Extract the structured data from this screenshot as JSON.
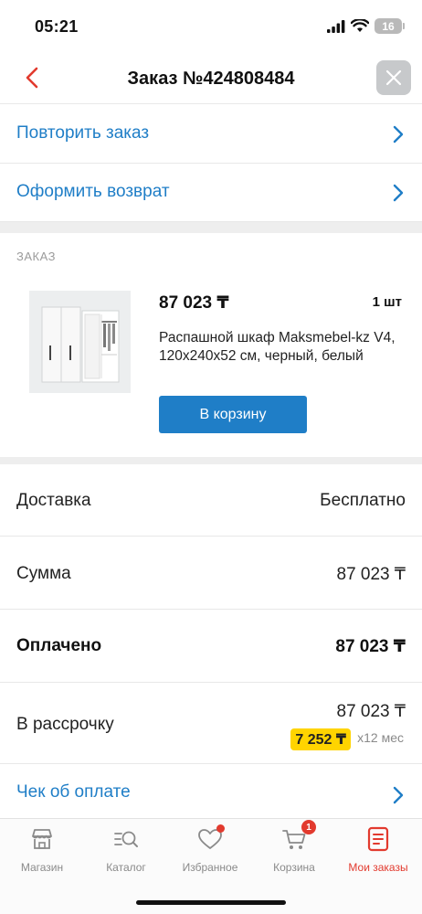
{
  "status_bar": {
    "time": "05:21",
    "battery": "16"
  },
  "header": {
    "title": "Заказ №424808484"
  },
  "actions": [
    {
      "label": "Повторить заказ"
    },
    {
      "label": "Оформить возврат"
    }
  ],
  "order_section": {
    "label": "ЗАКАЗ",
    "item": {
      "price": "87 023 ₸",
      "quantity": "1 шт",
      "name": "Распашной шкаф Maksmebel-kz V4, 120x240x52 см, черный, белый",
      "cart_button": "В корзину"
    }
  },
  "summary": {
    "delivery": {
      "label": "Доставка",
      "value": "Бесплатно"
    },
    "sum": {
      "label": "Сумма",
      "value": "87 023 ₸"
    },
    "paid": {
      "label": "Оплачено",
      "value": "87 023 ₸"
    },
    "installment": {
      "label": "В рассрочку",
      "value": "87 023 ₸",
      "monthly": "7 252 ₸",
      "term": "x12 мес"
    }
  },
  "receipt": {
    "label": "Чек об оплате"
  },
  "tabs": [
    {
      "label": "Магазин",
      "icon": "store-icon"
    },
    {
      "label": "Каталог",
      "icon": "catalog-search-icon"
    },
    {
      "label": "Избранное",
      "icon": "heart-icon"
    },
    {
      "label": "Корзина",
      "icon": "cart-icon",
      "badge": "1"
    },
    {
      "label": "Мои заказы",
      "icon": "orders-icon",
      "active": true
    }
  ],
  "colors": {
    "accent": "#1f7ec7",
    "active": "#e23a2e",
    "installment_badge": "#ffd400"
  }
}
